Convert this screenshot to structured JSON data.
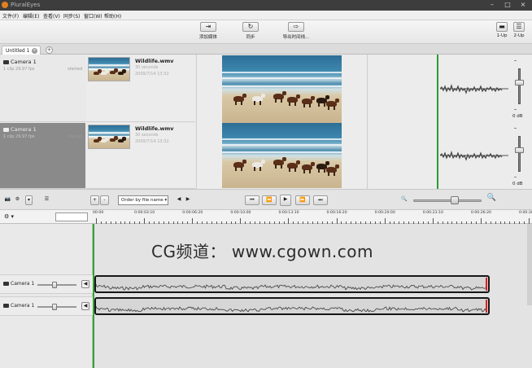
{
  "window": {
    "title": "PluralEyes"
  },
  "menu": [
    "文件(F)",
    "编辑(E)",
    "查看(V)",
    "同步(S)",
    "窗口(W)",
    "帮助(H)"
  ],
  "toolbar": {
    "add_media": "添加媒体",
    "sync": "同步",
    "export_timeline": "导出时间线...",
    "layout_1up": "1-Up",
    "layout_2up": "2-Up"
  },
  "tabs": [
    {
      "label": "Untitled 1"
    }
  ],
  "cameras": [
    {
      "name": "Camera 1",
      "info": "1 clip   29.97 fps",
      "status": "started",
      "selected": false
    },
    {
      "name": "Camera 1",
      "info": "1 clip   29.97 fps",
      "status": "started",
      "selected": true
    }
  ],
  "clips": [
    {
      "name": "Wildlife.wmv",
      "duration": "30 seconds",
      "date": "2009/7/14 13:32"
    },
    {
      "name": "Wildlife.wmv",
      "duration": "30 seconds",
      "date": "2009/7/14 13:32"
    }
  ],
  "audio_meters": [
    {
      "label": "0 dB"
    },
    {
      "label": "0 dB"
    }
  ],
  "transport": {
    "order_by": "Order by file name",
    "plus": "+",
    "minus": "-"
  },
  "ruler": {
    "labels": [
      "00:00",
      "0:00:03:10",
      "0:00:06:20",
      "0:00:10:00",
      "0:00:13:10",
      "0:00:16:20",
      "0:00:20:00",
      "0:00:23:10",
      "0:00:26:20",
      "0:00:30:00"
    ]
  },
  "tracks": [
    {
      "name": "Camera 1"
    },
    {
      "name": "Camera 1"
    }
  ],
  "watermark": "CG频道： www.cgown.com",
  "colors": {
    "playhead": "#34a534",
    "clip_border": "#161616",
    "selected_row": "#8a8a8a"
  }
}
